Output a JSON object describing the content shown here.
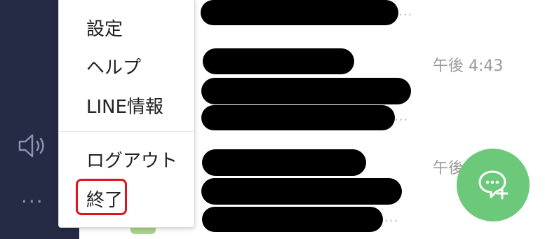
{
  "menu": {
    "items": [
      {
        "label": "設定"
      },
      {
        "label": "ヘルプ"
      },
      {
        "label": "LINE情報"
      },
      {
        "label": "ログアウト"
      },
      {
        "label": "終了"
      }
    ]
  },
  "chat_list": {
    "timestamps": [
      "午後 4:43",
      "午後"
    ],
    "ellipsis": "..."
  },
  "sidebar": {
    "more_label": "..."
  },
  "colors": {
    "sidebar_bg": "#252b45",
    "fab_green": "#6cc97a",
    "highlight_red": "#e0141e"
  },
  "icons": {
    "speaker": "speaker-icon",
    "new_chat": "new-chat-icon"
  }
}
